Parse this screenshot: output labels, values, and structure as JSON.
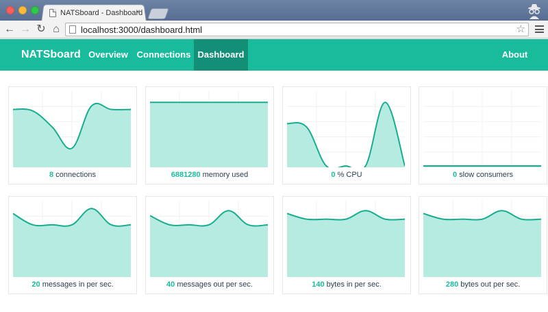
{
  "browser": {
    "tab_title": "NATSboard - Dashboard",
    "tab_close": "×",
    "url": "localhost:3000/dashboard.html",
    "back_glyph": "←",
    "forward_glyph": "→",
    "reload_glyph": "↻",
    "home_glyph": "⌂",
    "star_glyph": "☆"
  },
  "navbar": {
    "brand": "NATSboard",
    "links": {
      "overview": "Overview",
      "connections": "Connections",
      "dashboard": "Dashboard",
      "about": "About"
    },
    "active": "dashboard"
  },
  "colors": {
    "accent": "#18bc9c",
    "accent_dark": "#128f76",
    "area_fill": "#b5ebe0",
    "line": "#18ad8f",
    "text": "#2c3e50"
  },
  "panels": [
    {
      "value": "8",
      "label": "connections",
      "series": [
        0.8,
        0.78,
        0.55,
        0.25,
        0.85,
        0.8,
        0.8
      ]
    },
    {
      "value": "6881280",
      "label": "memory used",
      "series": [
        0.9,
        0.9,
        0.9,
        0.9,
        0.9,
        0.9,
        0.9
      ]
    },
    {
      "value": "0",
      "label": "% CPU",
      "series": [
        0.6,
        0.55,
        0.0,
        0.0,
        0.0,
        0.9,
        0.0
      ]
    },
    {
      "value": "0",
      "label": "slow consumers",
      "series": [
        0,
        0,
        0,
        0,
        0,
        0,
        0
      ]
    },
    {
      "value": "20",
      "label": "messages in per sec.",
      "series": [
        0.88,
        0.72,
        0.72,
        0.72,
        0.95,
        0.72,
        0.72
      ]
    },
    {
      "value": "40",
      "label": "messages out per sec.",
      "series": [
        0.85,
        0.72,
        0.72,
        0.72,
        0.92,
        0.72,
        0.72
      ]
    },
    {
      "value": "140",
      "label": "bytes in per sec.",
      "series": [
        0.88,
        0.8,
        0.8,
        0.8,
        0.92,
        0.8,
        0.8
      ]
    },
    {
      "value": "280",
      "label": "bytes out per sec.",
      "series": [
        0.88,
        0.8,
        0.8,
        0.8,
        0.92,
        0.8,
        0.8
      ]
    }
  ]
}
